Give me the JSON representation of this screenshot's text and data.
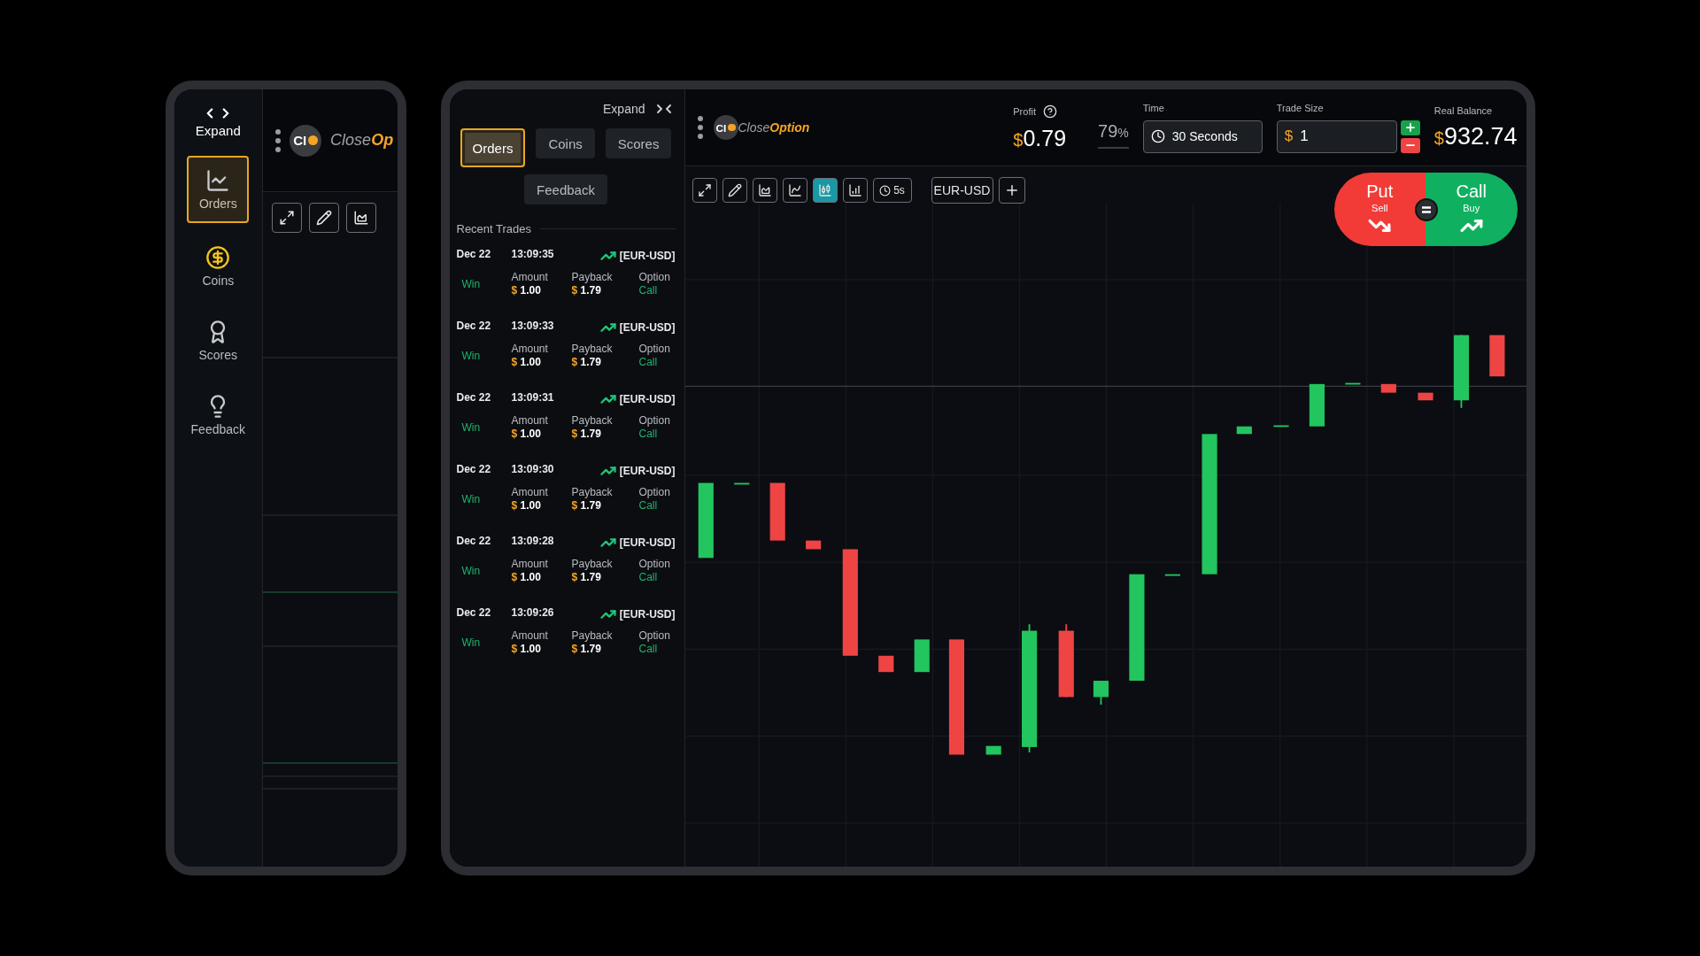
{
  "compact_view": {
    "sidebar": {
      "expand_label": "Expand",
      "items": [
        {
          "kind": "orders",
          "label": "Orders",
          "selected": true
        },
        {
          "kind": "coins",
          "label": "Coins",
          "selected": false
        },
        {
          "kind": "scores",
          "label": "Scores",
          "selected": false
        },
        {
          "kind": "feedback",
          "label": "Feedback",
          "selected": false
        }
      ]
    },
    "logo": {
      "mark": "CI",
      "name_plain": "Close",
      "name_accent": "Op"
    }
  },
  "expanded_view": {
    "panel": {
      "collapse_label": "Expand",
      "tabs": [
        {
          "label": "Orders",
          "selected": true
        },
        {
          "label": "Coins",
          "selected": false
        },
        {
          "label": "Scores",
          "selected": false
        },
        {
          "label": "Feedback",
          "selected": false
        }
      ],
      "section_title": "Recent Trades",
      "trades": [
        {
          "date": "Dec 22",
          "time": "13:09:35",
          "pair": "[EUR-USD]",
          "result": "Win",
          "amount_label": "Amount",
          "amount": "1.00",
          "payback_label": "Payback",
          "payback": "1.79",
          "option_label": "Option",
          "option": "Call",
          "currency": "$"
        },
        {
          "date": "Dec 22",
          "time": "13:09:33",
          "pair": "[EUR-USD]",
          "result": "Win",
          "amount_label": "Amount",
          "amount": "1.00",
          "payback_label": "Payback",
          "payback": "1.79",
          "option_label": "Option",
          "option": "Call",
          "currency": "$"
        },
        {
          "date": "Dec 22",
          "time": "13:09:31",
          "pair": "[EUR-USD]",
          "result": "Win",
          "amount_label": "Amount",
          "amount": "1.00",
          "payback_label": "Payback",
          "payback": "1.79",
          "option_label": "Option",
          "option": "Call",
          "currency": "$"
        },
        {
          "date": "Dec 22",
          "time": "13:09:30",
          "pair": "[EUR-USD]",
          "result": "Win",
          "amount_label": "Amount",
          "amount": "1.00",
          "payback_label": "Payback",
          "payback": "1.79",
          "option_label": "Option",
          "option": "Call",
          "currency": "$"
        },
        {
          "date": "Dec 22",
          "time": "13:09:28",
          "pair": "[EUR-USD]",
          "result": "Win",
          "amount_label": "Amount",
          "amount": "1.00",
          "payback_label": "Payback",
          "payback": "1.79",
          "option_label": "Option",
          "option": "Call",
          "currency": "$"
        },
        {
          "date": "Dec 22",
          "time": "13:09:26",
          "pair": "[EUR-USD]",
          "result": "Win",
          "amount_label": "Amount",
          "amount": "1.00",
          "payback_label": "Payback",
          "payback": "1.79",
          "option_label": "Option",
          "option": "Call",
          "currency": "$"
        }
      ]
    },
    "header": {
      "logo": {
        "mark": "CI",
        "name_plain": "Close",
        "name_accent": "Option"
      },
      "profit": {
        "label": "Profit",
        "currency": "$",
        "value": "0.79"
      },
      "payout": {
        "value": "79",
        "unit": "%"
      },
      "time": {
        "label": "Time",
        "value": "30 Seconds"
      },
      "trade_size": {
        "label": "Trade Size",
        "currency": "$",
        "value": "1"
      },
      "balance": {
        "label": "Real Balance",
        "currency": "$",
        "value": "932.74"
      }
    },
    "toolbar": {
      "tools": [
        {
          "kind": "fullscreen",
          "selected": false
        },
        {
          "kind": "draw",
          "selected": false
        },
        {
          "kind": "area",
          "selected": false
        },
        {
          "kind": "line",
          "selected": false
        },
        {
          "kind": "candles",
          "selected": true
        },
        {
          "kind": "bars",
          "selected": false
        }
      ],
      "timeframe": "5s",
      "pair": "EUR-USD"
    },
    "trade_buttons": {
      "put": {
        "label": "Put",
        "sub": "Sell"
      },
      "call": {
        "label": "Call",
        "sub": "Buy"
      }
    }
  }
}
